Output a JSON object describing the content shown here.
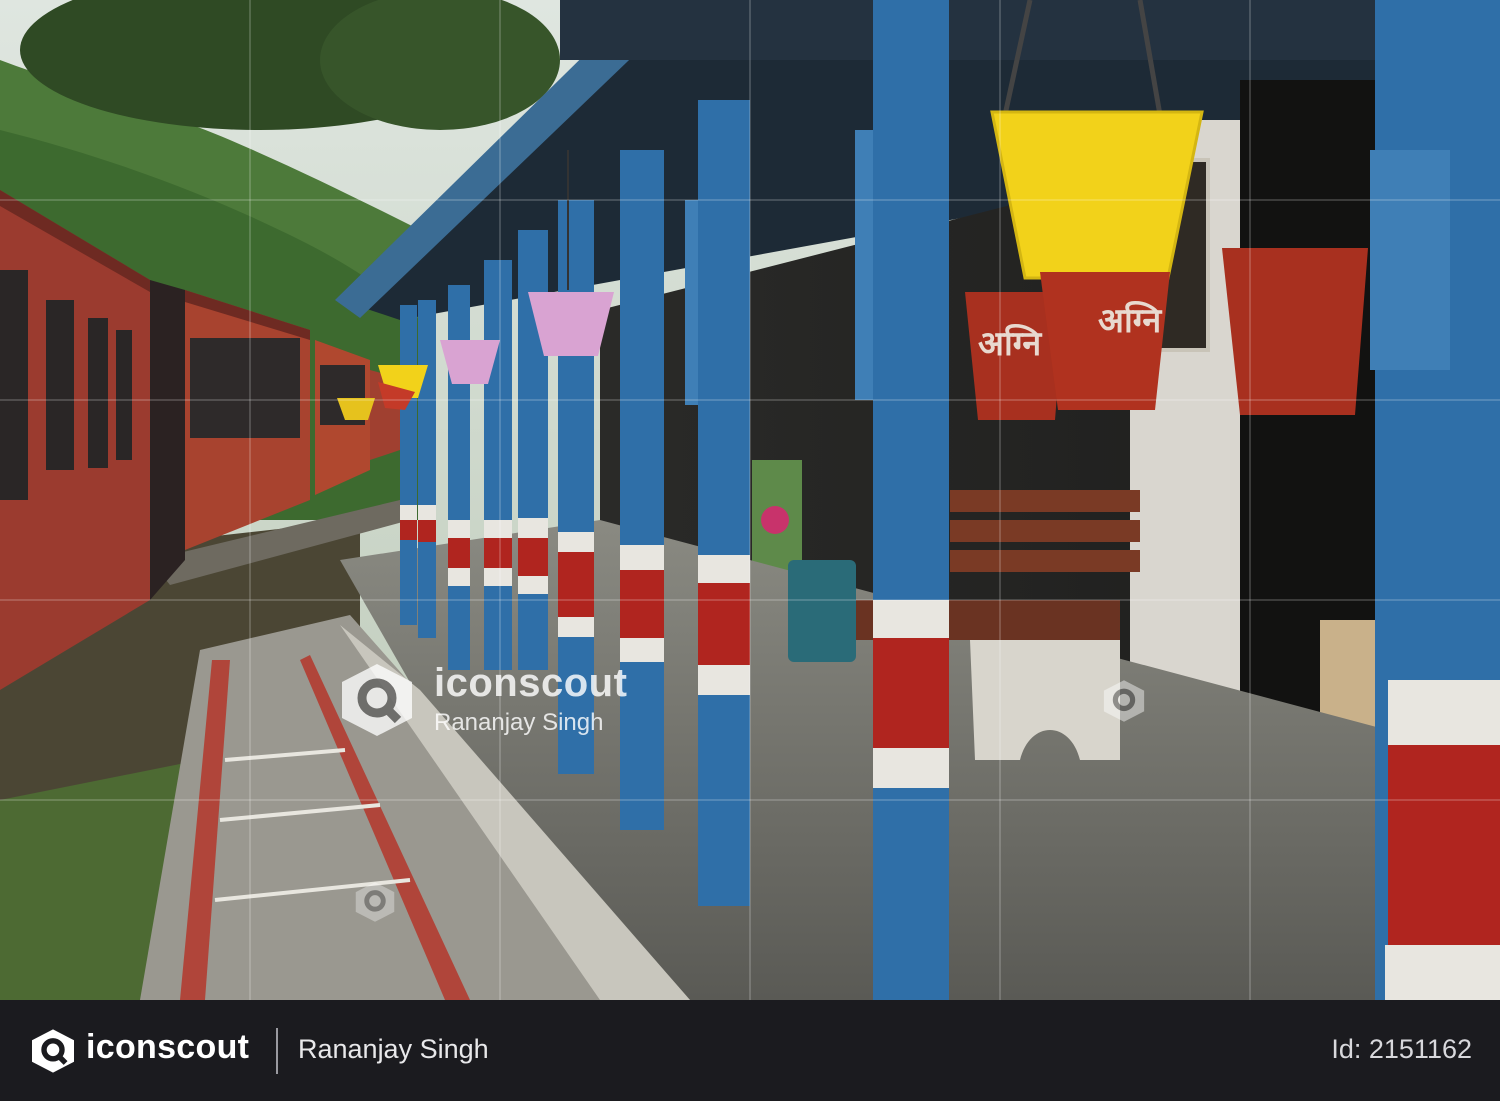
{
  "watermark": {
    "brand": "iconscout",
    "author": "Rananjay Singh"
  },
  "footer": {
    "brand": "iconscout",
    "author": "Rananjay Singh",
    "id_text": "Id: 2151162"
  },
  "pot_text": "अग्नि",
  "colors": {
    "pillar_blue": "#2f6fa8",
    "pillar_red": "#b0251f",
    "bucket_red": "#a8301f",
    "pot_yellow": "#f2d21a",
    "pot_pink": "#d9a3d2",
    "train_maroon": "#9b3b2f",
    "footer_bg": "#1b1b1f"
  },
  "icons": [
    "iconscout-logo-icon"
  ]
}
